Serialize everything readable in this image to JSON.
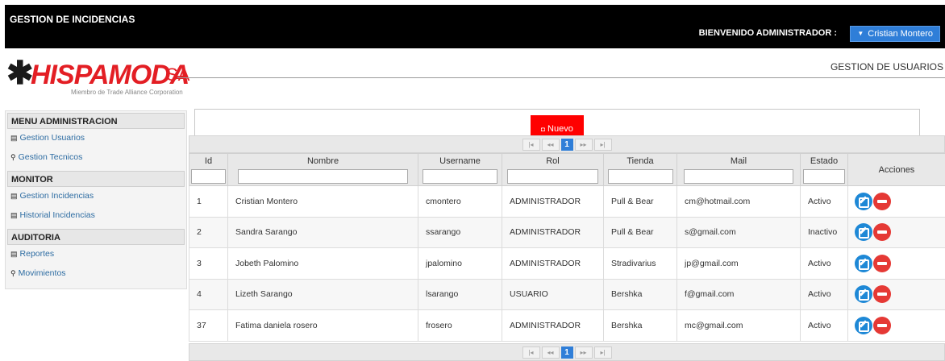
{
  "header": {
    "app_title": "GESTION DE INCIDENCIAS",
    "welcome": "BIENVENIDO ADMINISTRADOR :",
    "user_name": "Cristian Montero"
  },
  "logo": {
    "name": "HISPAMODA",
    "suffix": "SA",
    "tagline": "Miembro de Trade Alliance Corporation"
  },
  "section_title": "GESTION DE USUARIOS",
  "sidebar": {
    "groups": [
      {
        "label": "MENU ADMINISTRACION",
        "items": [
          {
            "label": "Gestion Usuarios",
            "icon": "list-icon"
          },
          {
            "label": "Gestion Tecnicos",
            "icon": "search-icon"
          }
        ]
      },
      {
        "label": "MONITOR",
        "items": [
          {
            "label": "Gestion Incidencias",
            "icon": "list-icon"
          },
          {
            "label": "Historial Incidencias",
            "icon": "list-icon"
          }
        ]
      },
      {
        "label": "AUDITORIA",
        "items": [
          {
            "label": "Reportes",
            "icon": "list-icon"
          },
          {
            "label": "Movimientos",
            "icon": "search-icon"
          }
        ]
      }
    ]
  },
  "toolbar": {
    "new_label": "Nuevo"
  },
  "pager": {
    "current_page": "1",
    "first": "|◂",
    "prev": "◂◂",
    "next": "▸▸",
    "last": "▸|"
  },
  "table": {
    "columns": [
      "Id",
      "Nombre",
      "Username",
      "Rol",
      "Tienda",
      "Mail",
      "Estado",
      "Acciones"
    ],
    "rows": [
      [
        "1",
        "Cristian Montero",
        "cmontero",
        "ADMINISTRADOR",
        "Pull & Bear",
        "cm@hotmail.com",
        "Activo"
      ],
      [
        "2",
        "Sandra Sarango",
        "ssarango",
        "ADMINISTRADOR",
        "Pull & Bear",
        "s@gmail.com",
        "Inactivo"
      ],
      [
        "3",
        "Jobeth Palomino",
        "jpalomino",
        "ADMINISTRADOR",
        "Stradivarius",
        "jp@gmail.com",
        "Activo"
      ],
      [
        "4",
        "Lizeth Sarango",
        "lsarango",
        "USUARIO",
        "Bershka",
        "f@gmail.com",
        "Activo"
      ],
      [
        "37",
        "Fatima daniela rosero",
        "frosero",
        "ADMINISTRADOR",
        "Bershka",
        "mc@gmail.com",
        "Activo"
      ]
    ]
  },
  "colors": {
    "accent": "#2f7ed8",
    "danger": "#ff0000",
    "brand": "#e31e24"
  }
}
